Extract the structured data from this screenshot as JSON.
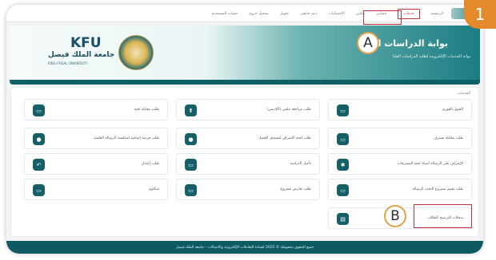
{
  "step_number": "1",
  "markers": {
    "a": "A",
    "b": "B"
  },
  "topnav": {
    "items": [
      {
        "label": "الرئيسية"
      },
      {
        "label": "خدمات"
      },
      {
        "label": "حسابي"
      },
      {
        "label": "مكتبي"
      },
      {
        "label": "الإحصائيات"
      },
      {
        "label": "دعم جامعي"
      },
      {
        "label": "تحويل"
      },
      {
        "label": "تسجيل خروج"
      },
      {
        "label": "حساب المستخدم"
      }
    ]
  },
  "banner": {
    "title": "بوابة الدراسات العليا",
    "subtitle": "بوابة الخدمات الإلكترونية لطلبة الدراسات العليا",
    "logo_latin": "KFU",
    "logo_arabic": "جامعة الملك فيصل",
    "logo_english": "KING FAISAL UNIVERSITY"
  },
  "section_label": "الخدمات",
  "services": [
    {
      "label": "القبول الفوري",
      "icon": "document-icon",
      "glyph": "▭"
    },
    {
      "label": "طلب مراجعة علمي (أكاديمي)",
      "icon": "upload-icon",
      "glyph": "⬆"
    },
    {
      "label": "طلب مقابلة لجنة",
      "icon": "document-icon",
      "glyph": "▭"
    },
    {
      "label": "طلب مقابلة مشرف",
      "icon": "document-icon",
      "glyph": "▭"
    },
    {
      "label": "طلب لجنة الإشراف لتسجيل الفصل",
      "icon": "chat-icon",
      "glyph": "●"
    },
    {
      "label": "طلب فرصة إضافية لمناقشة الرسالة العلمية",
      "icon": "chat-icon",
      "glyph": "●"
    },
    {
      "label": "الإشراف على الرسالة أستاذ لجنة المشرفات",
      "icon": "settings-icon",
      "glyph": "✱"
    },
    {
      "label": "تأجيل الدراسة",
      "icon": "document-icon",
      "glyph": "▭"
    },
    {
      "label": "طلب إعتذار",
      "icon": "reply-icon",
      "glyph": "↶"
    },
    {
      "label": "طلب تقييم مشروع البحث الرسالة",
      "icon": "document-icon",
      "glyph": "▭"
    },
    {
      "label": "طلب تعارض مشروع",
      "icon": "document-icon",
      "glyph": "▭"
    },
    {
      "label": "شكاوى",
      "icon": "document-icon",
      "glyph": "▭"
    },
    {
      "label": "سجلات الترشيح للطالب",
      "icon": "card-icon",
      "glyph": "▤"
    }
  ],
  "footer": "جميع الحقوق محفوظة © 2025 لعمادة التعاملات الإلكترونية والاتصالات - جامعة الملك فيصل",
  "colors": {
    "primary": "#155f66",
    "highlight": "#c5303b",
    "marker_ring": "#e0a24a",
    "badge": "#e58a2c"
  }
}
